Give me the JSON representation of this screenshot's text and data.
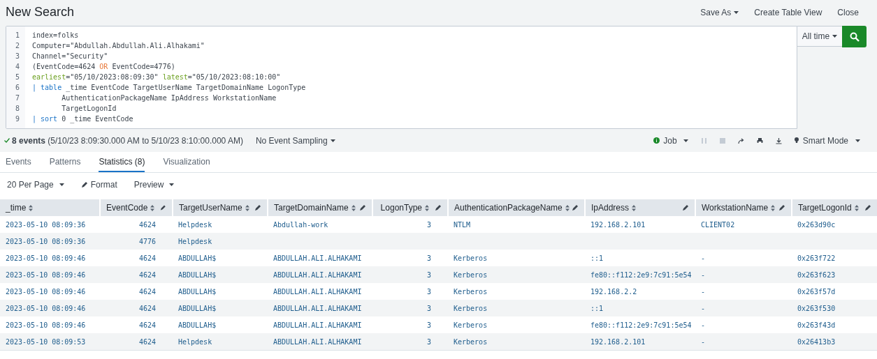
{
  "header": {
    "title": "New Search",
    "actions": [
      {
        "label": "Save As",
        "menu": true
      },
      {
        "label": "Create Table View",
        "menu": false
      },
      {
        "label": "Close",
        "menu": false
      }
    ]
  },
  "query": {
    "lines": [
      {
        "number": "1",
        "segments": [
          {
            "kind": "text",
            "text": "index=folks"
          }
        ]
      },
      {
        "number": "2",
        "segments": [
          {
            "kind": "text",
            "text": "Computer=\"Abdullah.Abdullah.Ali.Alhakami\""
          }
        ]
      },
      {
        "number": "3",
        "segments": [
          {
            "kind": "text",
            "text": "Channel=\"Security\""
          }
        ]
      },
      {
        "number": "4",
        "segments": [
          {
            "kind": "text",
            "text": "(EventCode=4624 "
          },
          {
            "kind": "operator",
            "text": "OR"
          },
          {
            "kind": "text",
            "text": " EventCode=4776)"
          }
        ]
      },
      {
        "number": "5",
        "segments": [
          {
            "kind": "argument",
            "text": "earliest"
          },
          {
            "kind": "text",
            "text": "=\"05/10/2023:08:09:30\" "
          },
          {
            "kind": "argument",
            "text": "latest"
          },
          {
            "kind": "text",
            "text": "=\"05/10/2023:08:10:00\""
          }
        ]
      },
      {
        "number": "6",
        "segments": [
          {
            "kind": "pipe",
            "text": "|"
          },
          {
            "kind": "command",
            "text": " table"
          },
          {
            "kind": "text",
            "text": " _time EventCode TargetUserName TargetDomainName LogonType"
          }
        ]
      },
      {
        "number": "7",
        "segments": [
          {
            "kind": "text",
            "text": "       AuthenticationPackageName IpAddress WorkstationName"
          }
        ]
      },
      {
        "number": "8",
        "segments": [
          {
            "kind": "text",
            "text": "       TargetLogonId"
          }
        ]
      },
      {
        "number": "9",
        "segments": [
          {
            "kind": "pipe",
            "text": "|"
          },
          {
            "kind": "command",
            "text": " sort"
          },
          {
            "kind": "text",
            "text": " 0 _time EventCode"
          }
        ]
      }
    ],
    "time_range": "All time"
  },
  "status": {
    "summary": "**8 events** (5/10/23 8:09:30.000 AM to 5/10/23 8:10:00.000 AM)",
    "sampling": "No Event Sampling",
    "job": "Job",
    "mode": "Smart Mode"
  },
  "tabs": [
    {
      "label": "Events",
      "selected": false
    },
    {
      "label": "Patterns",
      "selected": false
    },
    {
      "label": "Statistics (8)",
      "selected": true
    },
    {
      "label": "Visualization",
      "selected": false
    }
  ],
  "toolbar": {
    "per_page": "20 Per Page",
    "format": "Format",
    "preview": "Preview"
  },
  "table": {
    "columns": [
      {
        "label": "_time",
        "kind": "time"
      },
      {
        "label": "EventCode",
        "kind": "number"
      },
      {
        "label": "TargetUserName",
        "kind": "text"
      },
      {
        "label": "TargetDomainName",
        "kind": "text"
      },
      {
        "label": "LogonType",
        "kind": "number"
      },
      {
        "label": "AuthenticationPackageName",
        "kind": "text"
      },
      {
        "label": "IpAddress",
        "kind": "text"
      },
      {
        "label": "WorkstationName",
        "kind": "text"
      },
      {
        "label": "TargetLogonId",
        "kind": "text"
      }
    ],
    "rows": [
      [
        "2023-05-10 08:09:36",
        "4624",
        "Helpdesk",
        "Abdullah-work",
        "3",
        "NTLM",
        "192.168.2.101",
        "CLIENT02",
        "0x263d90c"
      ],
      [
        "2023-05-10 08:09:36",
        "4776",
        "Helpdesk",
        null,
        null,
        null,
        null,
        null,
        null
      ],
      [
        "2023-05-10 08:09:46",
        "4624",
        "ABDULLAH$",
        "ABDULLAH.ALI.ALHAKAMI",
        "3",
        "Kerberos",
        "::1",
        "-",
        "0x263f722"
      ],
      [
        "2023-05-10 08:09:46",
        "4624",
        "ABDULLAH$",
        "ABDULLAH.ALI.ALHAKAMI",
        "3",
        "Kerberos",
        "fe80::f112:2e9:7c91:5e54",
        "-",
        "0x263f623"
      ],
      [
        "2023-05-10 08:09:46",
        "4624",
        "ABDULLAH$",
        "ABDULLAH.ALI.ALHAKAMI",
        "3",
        "Kerberos",
        "192.168.2.2",
        "-",
        "0x263f57d"
      ],
      [
        "2023-05-10 08:09:46",
        "4624",
        "ABDULLAH$",
        "ABDULLAH.ALI.ALHAKAMI",
        "3",
        "Kerberos",
        "::1",
        "-",
        "0x263f530"
      ],
      [
        "2023-05-10 08:09:46",
        "4624",
        "ABDULLAH$",
        "ABDULLAH.ALI.ALHAKAMI",
        "3",
        "Kerberos",
        "fe80::f112:2e9:7c91:5e54",
        "-",
        "0x263f43d"
      ],
      [
        "2023-05-10 08:09:53",
        "4624",
        "Helpdesk",
        "ABDULLAH.ALI.ALHAKAMI",
        "3",
        "Kerberos",
        "192.168.2.101",
        "-",
        "0x26413b3"
      ]
    ]
  }
}
